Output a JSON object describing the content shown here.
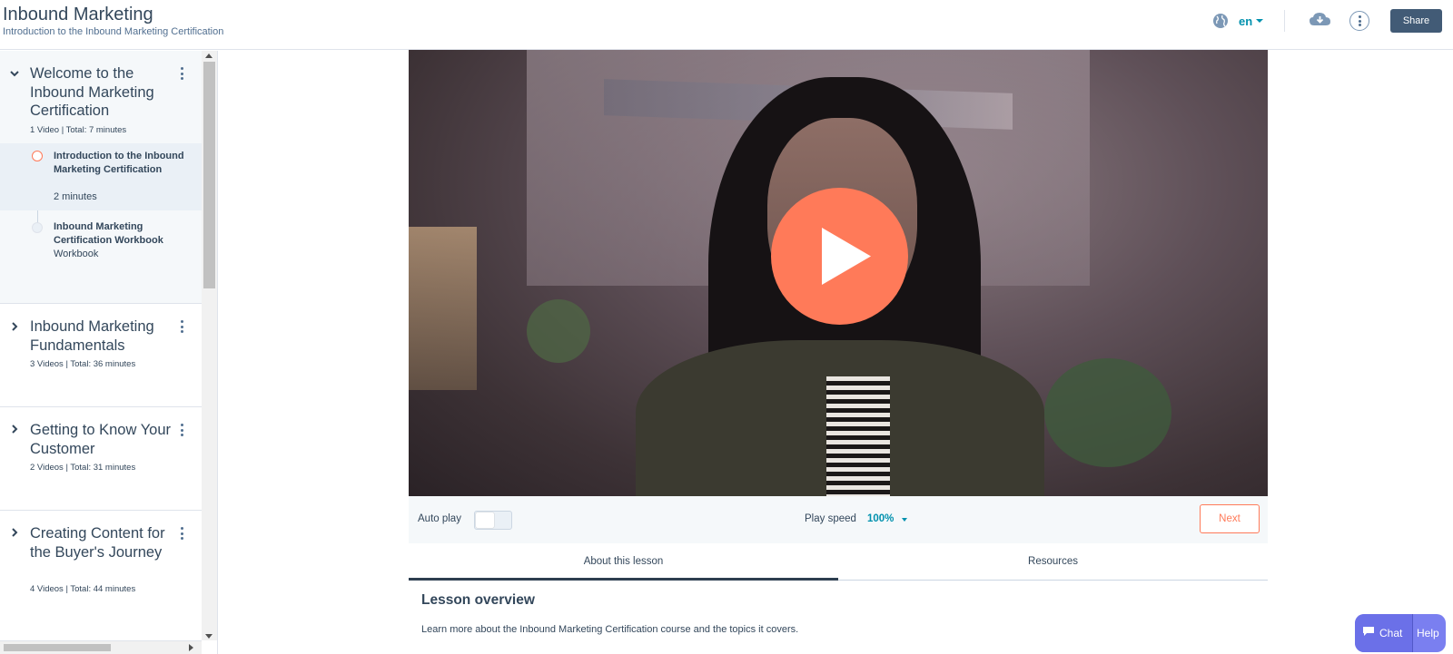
{
  "header": {
    "title": "Inbound Marketing",
    "subtitle": "Introduction to the Inbound Marketing Certification",
    "language": "en",
    "share_label": "Share"
  },
  "sidebar": {
    "sections": [
      {
        "title": "Welcome to the Inbound Marketing Certification",
        "meta": "1 Video | Total: 7 minutes",
        "expanded": true,
        "lessons": [
          {
            "title": "Introduction to the Inbound Marketing Certification",
            "sub": "2 minutes",
            "current": true
          },
          {
            "title": "Inbound Marketing Certification Workbook",
            "sub": "Workbook",
            "current": false
          }
        ]
      },
      {
        "title": "Inbound Marketing Fundamentals",
        "meta": "3 Videos | Total: 36 minutes",
        "expanded": false
      },
      {
        "title": "Getting to Know Your Customer",
        "meta": "2 Videos | Total: 31 minutes",
        "expanded": false
      },
      {
        "title": "Creating Content for the Buyer's Journey",
        "meta": "4 Videos | Total: 44 minutes",
        "expanded": false
      }
    ]
  },
  "player": {
    "autoplay_label": "Auto play",
    "autoplay_on": false,
    "speed_label": "Play speed",
    "speed_value": "100%",
    "next_label": "Next"
  },
  "tabs": [
    {
      "label": "About this lesson",
      "active": true
    },
    {
      "label": "Resources",
      "active": false
    }
  ],
  "overview": {
    "title": "Lesson overview",
    "text": "Learn more about the Inbound Marketing Certification course and the topics it covers."
  },
  "chat_widget": {
    "chat_label": "Chat",
    "help_label": "Help"
  },
  "colors": {
    "accent": "#ff7a59",
    "link": "#0091ae",
    "text": "#33475b",
    "share_button": "#425b76",
    "chat_widget": "#6b70e8"
  }
}
